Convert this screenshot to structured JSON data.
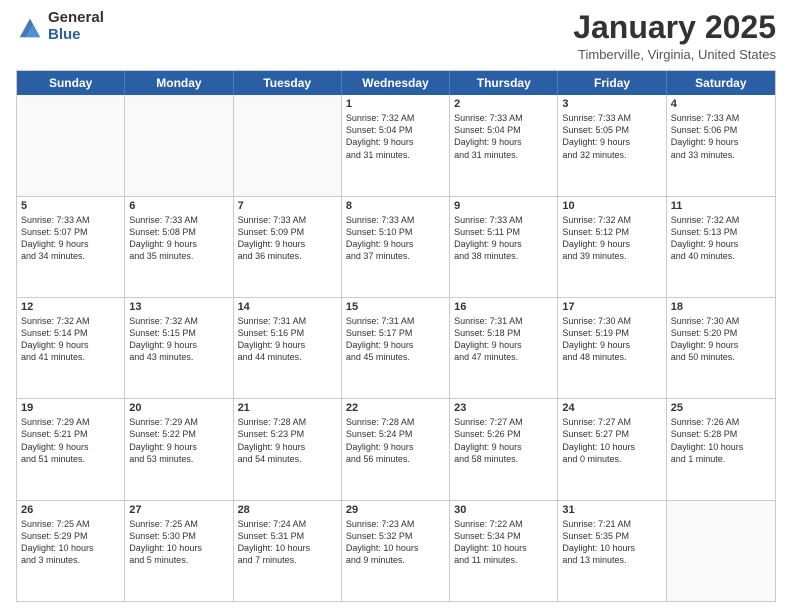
{
  "header": {
    "logo_general": "General",
    "logo_blue": "Blue",
    "month_title": "January 2025",
    "location": "Timberville, Virginia, United States"
  },
  "days_of_week": [
    "Sunday",
    "Monday",
    "Tuesday",
    "Wednesday",
    "Thursday",
    "Friday",
    "Saturday"
  ],
  "weeks": [
    [
      {
        "day": "",
        "info": ""
      },
      {
        "day": "",
        "info": ""
      },
      {
        "day": "",
        "info": ""
      },
      {
        "day": "1",
        "info": "Sunrise: 7:32 AM\nSunset: 5:04 PM\nDaylight: 9 hours\nand 31 minutes."
      },
      {
        "day": "2",
        "info": "Sunrise: 7:33 AM\nSunset: 5:04 PM\nDaylight: 9 hours\nand 31 minutes."
      },
      {
        "day": "3",
        "info": "Sunrise: 7:33 AM\nSunset: 5:05 PM\nDaylight: 9 hours\nand 32 minutes."
      },
      {
        "day": "4",
        "info": "Sunrise: 7:33 AM\nSunset: 5:06 PM\nDaylight: 9 hours\nand 33 minutes."
      }
    ],
    [
      {
        "day": "5",
        "info": "Sunrise: 7:33 AM\nSunset: 5:07 PM\nDaylight: 9 hours\nand 34 minutes."
      },
      {
        "day": "6",
        "info": "Sunrise: 7:33 AM\nSunset: 5:08 PM\nDaylight: 9 hours\nand 35 minutes."
      },
      {
        "day": "7",
        "info": "Sunrise: 7:33 AM\nSunset: 5:09 PM\nDaylight: 9 hours\nand 36 minutes."
      },
      {
        "day": "8",
        "info": "Sunrise: 7:33 AM\nSunset: 5:10 PM\nDaylight: 9 hours\nand 37 minutes."
      },
      {
        "day": "9",
        "info": "Sunrise: 7:33 AM\nSunset: 5:11 PM\nDaylight: 9 hours\nand 38 minutes."
      },
      {
        "day": "10",
        "info": "Sunrise: 7:32 AM\nSunset: 5:12 PM\nDaylight: 9 hours\nand 39 minutes."
      },
      {
        "day": "11",
        "info": "Sunrise: 7:32 AM\nSunset: 5:13 PM\nDaylight: 9 hours\nand 40 minutes."
      }
    ],
    [
      {
        "day": "12",
        "info": "Sunrise: 7:32 AM\nSunset: 5:14 PM\nDaylight: 9 hours\nand 41 minutes."
      },
      {
        "day": "13",
        "info": "Sunrise: 7:32 AM\nSunset: 5:15 PM\nDaylight: 9 hours\nand 43 minutes."
      },
      {
        "day": "14",
        "info": "Sunrise: 7:31 AM\nSunset: 5:16 PM\nDaylight: 9 hours\nand 44 minutes."
      },
      {
        "day": "15",
        "info": "Sunrise: 7:31 AM\nSunset: 5:17 PM\nDaylight: 9 hours\nand 45 minutes."
      },
      {
        "day": "16",
        "info": "Sunrise: 7:31 AM\nSunset: 5:18 PM\nDaylight: 9 hours\nand 47 minutes."
      },
      {
        "day": "17",
        "info": "Sunrise: 7:30 AM\nSunset: 5:19 PM\nDaylight: 9 hours\nand 48 minutes."
      },
      {
        "day": "18",
        "info": "Sunrise: 7:30 AM\nSunset: 5:20 PM\nDaylight: 9 hours\nand 50 minutes."
      }
    ],
    [
      {
        "day": "19",
        "info": "Sunrise: 7:29 AM\nSunset: 5:21 PM\nDaylight: 9 hours\nand 51 minutes."
      },
      {
        "day": "20",
        "info": "Sunrise: 7:29 AM\nSunset: 5:22 PM\nDaylight: 9 hours\nand 53 minutes."
      },
      {
        "day": "21",
        "info": "Sunrise: 7:28 AM\nSunset: 5:23 PM\nDaylight: 9 hours\nand 54 minutes."
      },
      {
        "day": "22",
        "info": "Sunrise: 7:28 AM\nSunset: 5:24 PM\nDaylight: 9 hours\nand 56 minutes."
      },
      {
        "day": "23",
        "info": "Sunrise: 7:27 AM\nSunset: 5:26 PM\nDaylight: 9 hours\nand 58 minutes."
      },
      {
        "day": "24",
        "info": "Sunrise: 7:27 AM\nSunset: 5:27 PM\nDaylight: 10 hours\nand 0 minutes."
      },
      {
        "day": "25",
        "info": "Sunrise: 7:26 AM\nSunset: 5:28 PM\nDaylight: 10 hours\nand 1 minute."
      }
    ],
    [
      {
        "day": "26",
        "info": "Sunrise: 7:25 AM\nSunset: 5:29 PM\nDaylight: 10 hours\nand 3 minutes."
      },
      {
        "day": "27",
        "info": "Sunrise: 7:25 AM\nSunset: 5:30 PM\nDaylight: 10 hours\nand 5 minutes."
      },
      {
        "day": "28",
        "info": "Sunrise: 7:24 AM\nSunset: 5:31 PM\nDaylight: 10 hours\nand 7 minutes."
      },
      {
        "day": "29",
        "info": "Sunrise: 7:23 AM\nSunset: 5:32 PM\nDaylight: 10 hours\nand 9 minutes."
      },
      {
        "day": "30",
        "info": "Sunrise: 7:22 AM\nSunset: 5:34 PM\nDaylight: 10 hours\nand 11 minutes."
      },
      {
        "day": "31",
        "info": "Sunrise: 7:21 AM\nSunset: 5:35 PM\nDaylight: 10 hours\nand 13 minutes."
      },
      {
        "day": "",
        "info": ""
      }
    ]
  ]
}
